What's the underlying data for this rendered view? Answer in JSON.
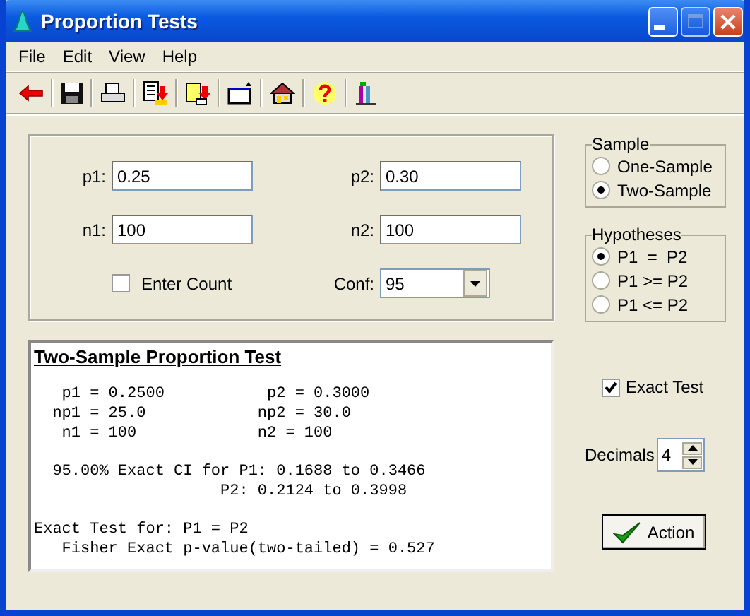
{
  "window": {
    "title": "Proportion Tests"
  },
  "menu": [
    {
      "label": "File"
    },
    {
      "label": "Edit"
    },
    {
      "label": "View"
    },
    {
      "label": "Help"
    }
  ],
  "fields": [
    {
      "label": "p1:",
      "value": "0.25"
    },
    {
      "label": "p2:",
      "value": "0.30"
    },
    {
      "label": "n1:",
      "value": "100"
    },
    {
      "label": "n2:",
      "value": "100"
    }
  ],
  "enter_count": {
    "label": "Enter Count",
    "checked": false
  },
  "conf": {
    "label": "Conf:",
    "value": "95"
  },
  "sample": {
    "title": "Sample",
    "options": [
      {
        "label": "One-Sample",
        "selected": false
      },
      {
        "label": "Two-Sample",
        "selected": true
      }
    ]
  },
  "hypotheses": {
    "title": "Hypotheses",
    "options": [
      {
        "label": "P1  =  P2",
        "selected": true
      },
      {
        "label": "P1 >= P2",
        "selected": false
      },
      {
        "label": "P1 <= P2",
        "selected": false
      }
    ]
  },
  "report": {
    "title": "Two-Sample Proportion Test",
    "blocks": [
      [
        "   p1 = 0.2500           p2 = 0.3000",
        "  np1 = 25.0            np2 = 30.0",
        "   n1 = 100             n2 = 100"
      ],
      [
        "  95.00% Exact CI for P1: 0.1688 to 0.3466",
        "                    P2: 0.2124 to 0.3998"
      ],
      [
        "Exact Test for: P1 = P2",
        "   Fisher Exact p-value(two-tailed) = 0.527"
      ]
    ]
  },
  "exact_test": {
    "label": "Exact Test",
    "checked": true
  },
  "decimals": {
    "label": "Decimals",
    "value": "4"
  },
  "action": {
    "label": "Action"
  }
}
